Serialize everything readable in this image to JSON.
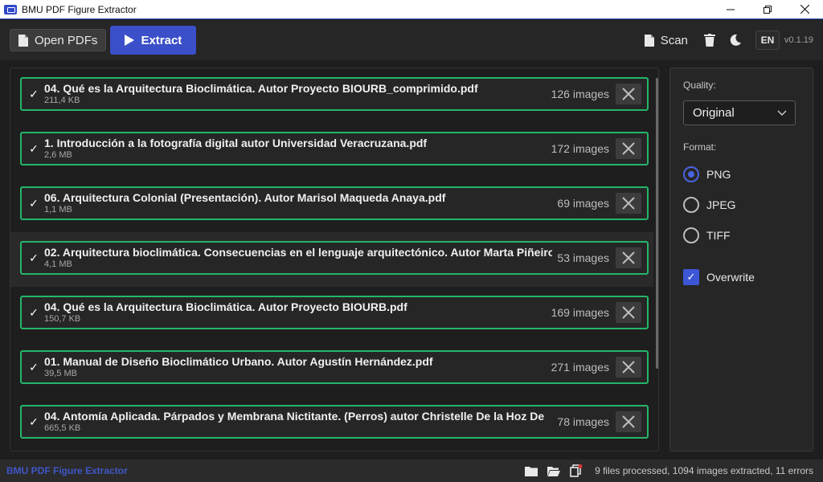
{
  "window": {
    "title": "BMU PDF Figure Extractor",
    "minimize": "—",
    "maximize": "❐",
    "close": "✕"
  },
  "toolbar": {
    "open_label": "Open PDFs",
    "extract_label": "Extract",
    "scan_label": "Scan",
    "lang": "EN",
    "version": "v0.1.19"
  },
  "files": [
    {
      "name": "04. Qué es la Arquitectura Bioclimática. Autor Proyecto BIOURB_comprimido.pdf",
      "size": "211,4 KB",
      "images": "126 images"
    },
    {
      "name": "1. Introducción a la fotografía digital autor Universidad Veracruzana.pdf",
      "size": "2,6 MB",
      "images": "172 images"
    },
    {
      "name": "06. Arquitectura Colonial (Presentación). Autor Marisol Maqueda Anaya.pdf",
      "size": "1,1 MB",
      "images": "69 images"
    },
    {
      "name": "02. Arquitectura bioclimática. Consecuencias en el lenguaje arquitectónico. Autor Marta Piñeiro",
      "size": "4,1 MB",
      "images": "53 images"
    },
    {
      "name": "04. Qué es la Arquitectura Bioclimática. Autor Proyecto BIOURB.pdf",
      "size": "150,7 KB",
      "images": "169 images"
    },
    {
      "name": "01. Manual de Diseño Bioclimático Urbano. Autor Agustín Hernández.pdf",
      "size": "39,5 MB",
      "images": "271 images"
    },
    {
      "name": "04. Antomía Aplicada. Párpados y Membrana Nictitante. (Perros) autor Christelle De la Hoz De",
      "size": "665,5 KB",
      "images": "78 images"
    }
  ],
  "settings": {
    "quality_label": "Quality:",
    "quality_value": "Original",
    "format_label": "Format:",
    "formats": [
      "PNG",
      "JPEG",
      "TIFF"
    ],
    "selected_format": "PNG",
    "overwrite_label": "Overwrite"
  },
  "status": {
    "app_name": "BMU PDF Figure Extractor",
    "summary": "9 files processed, 1094 images extracted, 11 errors"
  },
  "colors": {
    "accent": "#3a4fc8",
    "success_border": "#25b56a",
    "background": "#1e1e1e"
  }
}
